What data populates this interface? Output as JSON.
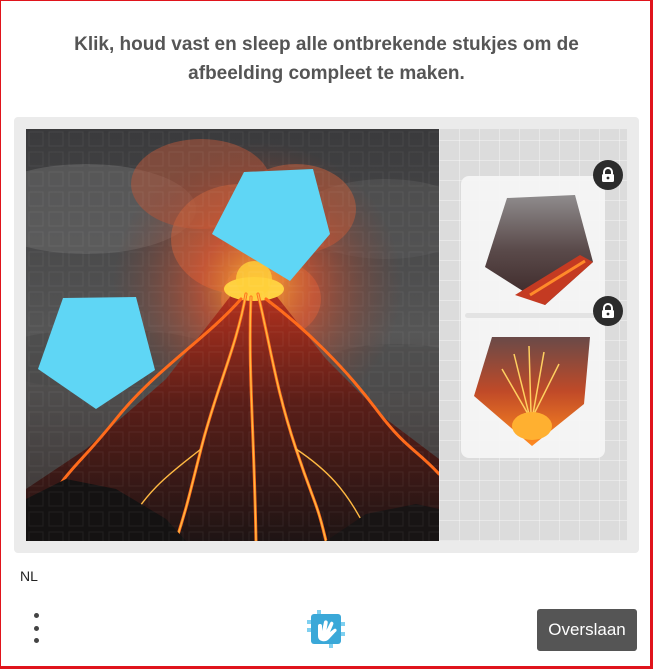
{
  "captcha": {
    "instruction": "Klik, houd vast en sleep alle ontbrekende stukjes om de afbeelding compleet te maken.",
    "language": "NL",
    "skip_label": "Overslaan"
  },
  "icons": {
    "menu": "vertical-dots-icon",
    "lock": "lock-icon",
    "brand": "hand-logo-icon"
  },
  "colors": {
    "missing_slot": "#5fd6f5",
    "frame": "#e0141c",
    "skip_button": "#555555",
    "instruction_text": "#555555"
  }
}
